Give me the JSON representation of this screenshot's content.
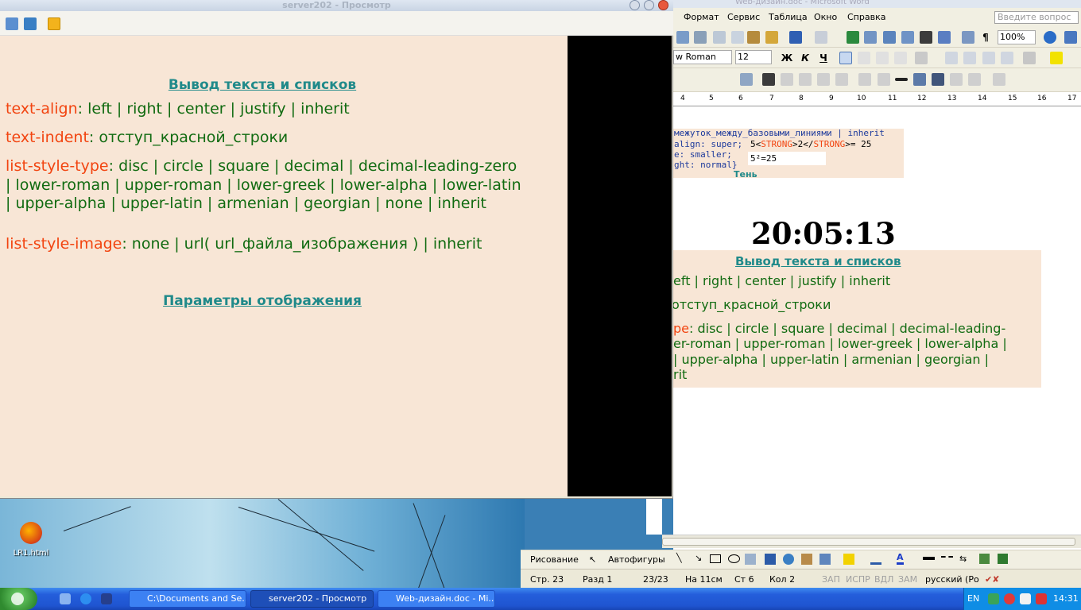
{
  "viewer": {
    "title": "server202 - Просмотр",
    "content": {
      "heading1": "Вывод текста и списков",
      "heading2": "Параметры отображения",
      "lines": [
        {
          "prop": "text-align",
          "values": ": left | right | center | justify | inherit"
        },
        {
          "prop": "text-indent",
          "values": ": отступ_красной_строки"
        },
        {
          "prop": "list-style-type",
          "values": ": disc | circle | square | decimal | decimal-leading-zero | lower-roman | upper-roman | lower-greek | lower-alpha | lower-latin | upper-alpha | upper-latin | armenian | georgian | none | inherit"
        },
        {
          "prop": "list-style-image",
          "values": ": none | url( url_файла_изображения ) | inherit"
        }
      ]
    }
  },
  "desktop": {
    "icon_label": "LR1.html"
  },
  "word": {
    "title": "Web-дизайн.doc - Microsoft Word",
    "menu": [
      "Формат",
      "Сервис",
      "Таблица",
      "Окно",
      "Справка"
    ],
    "ask_placeholder": "Введите вопрос",
    "zoom": "100%",
    "font": "w Roman",
    "font_size": "12",
    "bold": "Ж",
    "italic": "К",
    "underline": "Ч",
    "ruler_numbers": [
      "4",
      "5",
      "6",
      "7",
      "8",
      "9",
      "10",
      "11",
      "12",
      "13",
      "14",
      "15",
      "16",
      "17"
    ],
    "doc": {
      "box1_rows": [
        "межуток_между_базовыми_линиями | inherit",
        "align: super;",
        "e: smaller;",
        "ght: normal}"
      ],
      "code_line_prefix": "5<",
      "code_tag_open": "STRONG",
      "code_mid": ">2</",
      "code_tag_close": "STRONG",
      "code_suffix": ">= 25",
      "sample_text": "5²=25",
      "shadow_label": "Тень",
      "clock": "20:05:13",
      "box2_heading": "Вывод текста и списков",
      "box2_lines": [
        "eft | right | center | justify | inherit",
        "  отступ_красной_строки",
        "pe: disc | circle | square | decimal | decimal-leading-",
        "er-roman | upper-roman | lower-greek | lower-alpha |",
        "| upper-alpha | upper-latin | armenian | georgian |",
        "rit"
      ],
      "box2_prop_fragment": "pe"
    },
    "draw_label": "Рисование",
    "autoshapes_label": "Автофигуры",
    "status": {
      "page": "Стр. 23",
      "section": "Разд 1",
      "pages": "23/23",
      "at": "На 11см",
      "line": "Ст 6",
      "col": "Кол 2",
      "rec": "ЗАП",
      "trk": "ИСПР",
      "ext": "ВДЛ",
      "ovr": "ЗАМ",
      "lang": "русский (Ро"
    }
  },
  "taskbar": {
    "tasks": [
      "C:\\Documents and Se...",
      "server202 - Просмотр",
      "Web-дизайн.doc - Mi..."
    ],
    "lang": "EN",
    "time": "14:31"
  }
}
